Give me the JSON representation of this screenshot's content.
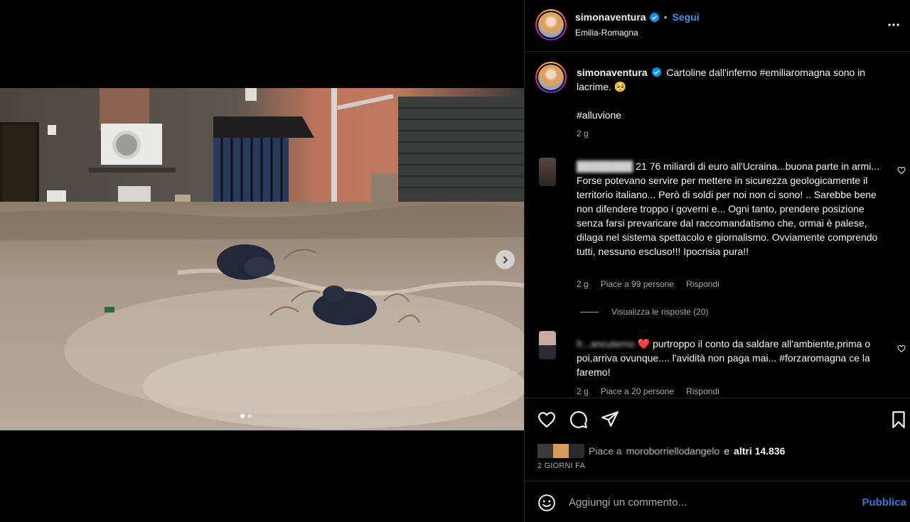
{
  "post": {
    "author": "simonaventura",
    "location": "Emilia-Romagna",
    "follow_label": "Segui",
    "separator": "•"
  },
  "caption": {
    "user": "simonaventura",
    "text": "Cartoline dall'inferno #emiliaromagna sono in lacrime. ",
    "emoji": "🥺",
    "hashtag": "#alluvione",
    "time": "2 g"
  },
  "comments": [
    {
      "user_blurred": "████████",
      "text_tail": "21 76 miliardi di euro all'Ucraina...buona parte in armi...",
      "body": "Forse potevano servire per mettere in sicurezza geologicamente il territorio italiano... Però di soldi per noi non ci sono! .. Sarebbe bene non difendere troppo i governi e... Ogni tanto, prendere posizione senza farsi prevaricare dal raccomandatismo che, ormai è palese, dilaga nel sistema spettacolo e giornalismo. Ovviamente comprendo tutti, nessuno escluso!!! Ipocrisia pura!!",
      "time": "2 g",
      "likes": "Piace a 99 persone",
      "reply": "Rispondi",
      "view_replies": "Visualizza le risposte (20)"
    },
    {
      "user_blurred": "fr...ancuterno",
      "emoji": "❤️",
      "text": "purtroppo il conto da saldare all'ambiente,prima o poi,arriva ovunque.... l'avidità non paga mai... #forzaromagna ce la faremo!",
      "time": "2 g",
      "likes": "Piace a 20 persone",
      "reply": "Rispondi"
    }
  ],
  "likes_line": {
    "prefix": "Piace a",
    "user": "moroborriellodangelo",
    "joiner": "e",
    "others": "altri 14.836"
  },
  "time_ago": "2 GIORNI FA",
  "add_comment": {
    "placeholder": "Aggiungi un commento...",
    "publish": "Pubblica"
  },
  "icons": {
    "verified": "verified-badge-icon",
    "more": "more-options-icon",
    "like": "heart-icon",
    "comment": "comment-bubble-icon",
    "share": "paper-plane-icon",
    "save": "bookmark-icon",
    "emoji": "smiley-icon",
    "next": "chevron-right-icon"
  },
  "colors": {
    "background": "#000000",
    "link_blue": "#4193ef",
    "muted": "#a8a8a8",
    "border": "#262626"
  }
}
